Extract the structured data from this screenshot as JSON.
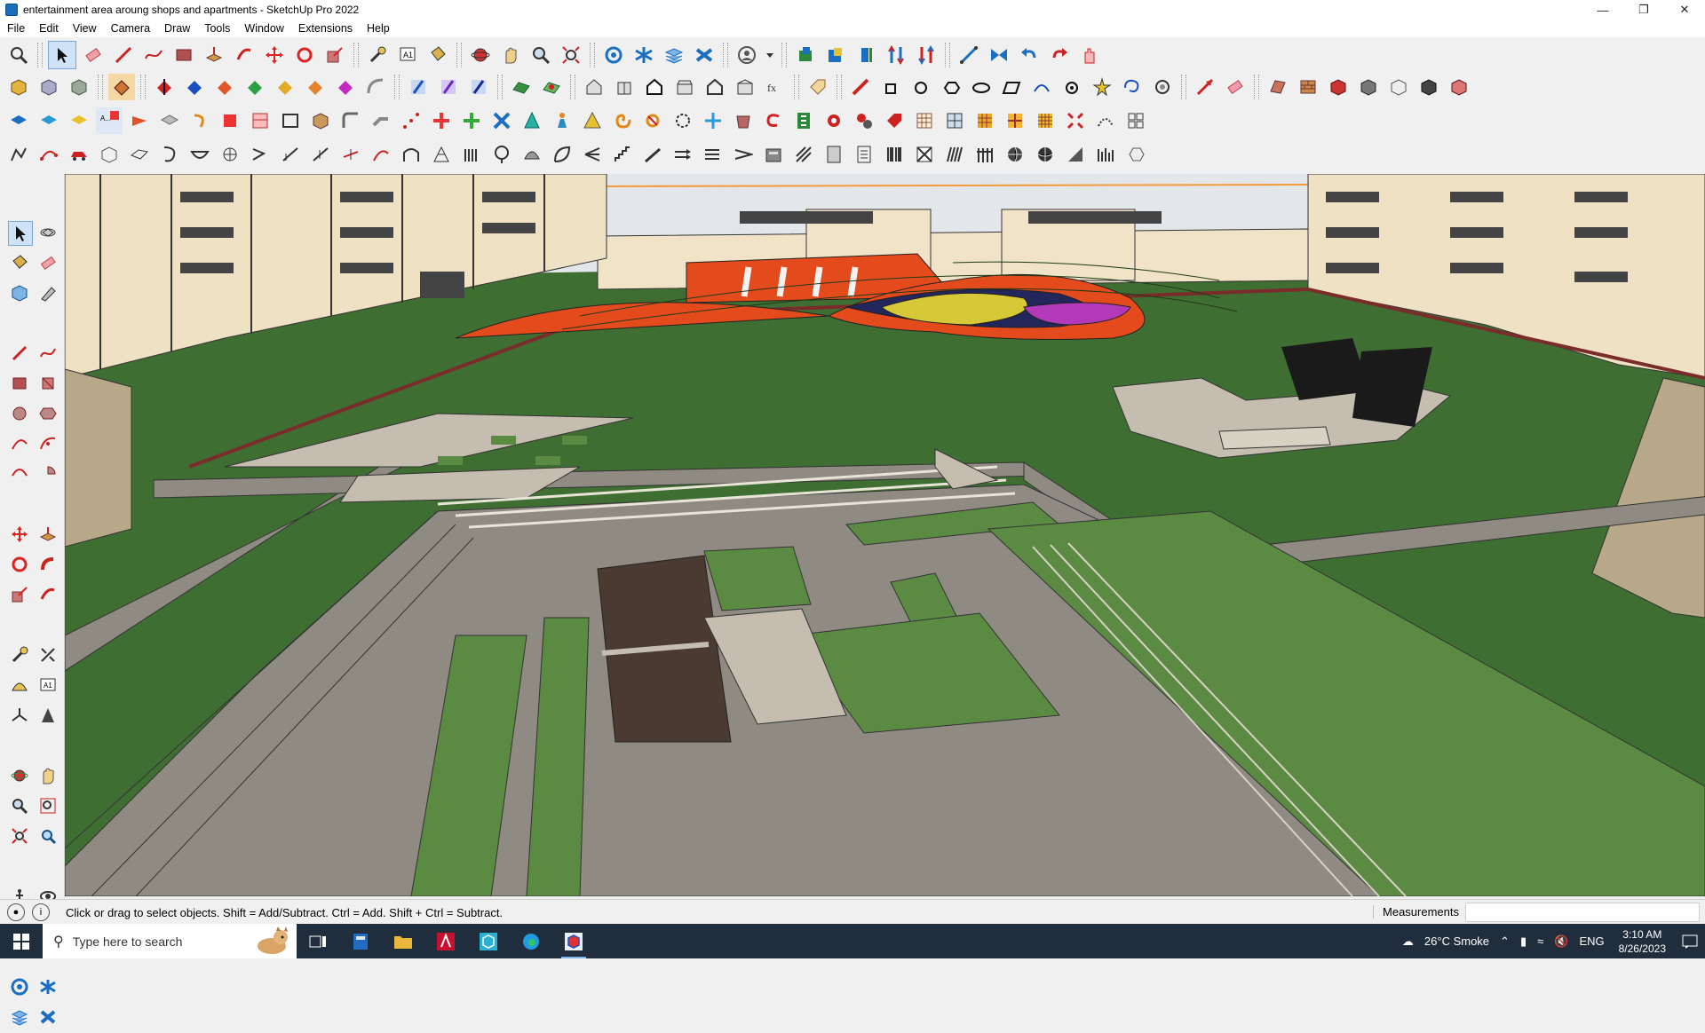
{
  "window": {
    "title": "entertainment area aroung shops and apartments - SketchUp Pro 2022"
  },
  "menus": [
    "File",
    "Edit",
    "View",
    "Camera",
    "Draw",
    "Tools",
    "Window",
    "Extensions",
    "Help"
  ],
  "status": {
    "hint": "Click or drag to select objects. Shift = Add/Subtract. Ctrl = Add. Shift + Ctrl = Subtract.",
    "measurements_label": "Measurements",
    "measurements_value": ""
  },
  "taskbar": {
    "search_placeholder": "Type here to search",
    "weather": "26°C  Smoke",
    "lang": "ENG",
    "time": "3:10 AM",
    "date": "8/26/2023"
  },
  "colors": {
    "grass": "#3f6e33",
    "grass_light": "#5b8a43",
    "path": "#9a9489",
    "orange": "#e44b1c",
    "dark": "#1a1a1a"
  }
}
